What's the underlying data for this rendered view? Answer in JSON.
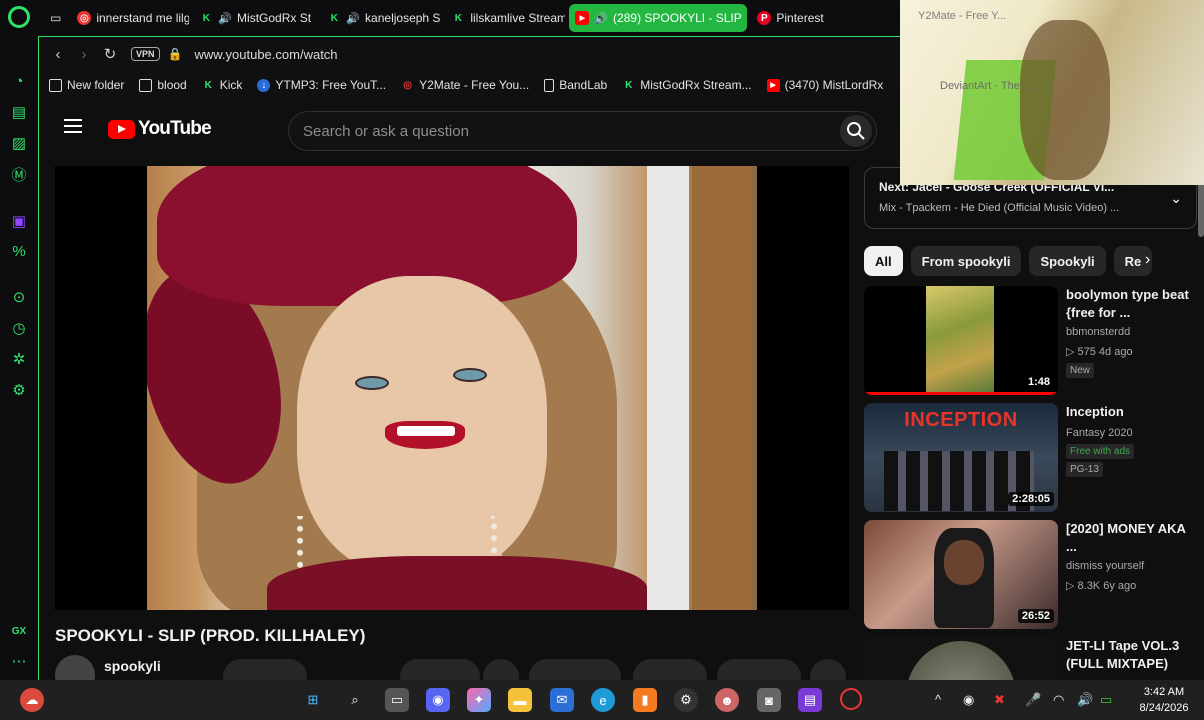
{
  "tabs": [
    {
      "label": "innerstand me lilg",
      "color": "#e33"
    },
    {
      "label": "MistGodRx St",
      "color": "#2fe26a",
      "audio": true
    },
    {
      "label": "kaneljoseph S",
      "color": "#2fe26a",
      "audio": true
    },
    {
      "label": "lilskamlive Stream",
      "color": "#2fe26a"
    },
    {
      "label": "(289) SPOOKYLI - SLIP",
      "color": "#ff0000",
      "audio": true,
      "active": true
    },
    {
      "label": "Pinterest",
      "color": "#e60023"
    }
  ],
  "address": {
    "vpn": "VPN",
    "url": "www.youtube.com/watch"
  },
  "bookmarks": [
    {
      "label": "New folder",
      "icon": "folder-icon"
    },
    {
      "label": "blood",
      "icon": "folder-icon"
    },
    {
      "label": "Kick",
      "icon": "kick-icon"
    },
    {
      "label": "YTMP3: Free YouT...",
      "icon": "download-icon"
    },
    {
      "label": "Y2Mate - Free You...",
      "icon": "y2mate-icon"
    },
    {
      "label": "BandLab",
      "icon": "document-icon"
    },
    {
      "label": "MistGodRx Stream...",
      "icon": "kick-icon"
    },
    {
      "label": "(3470) MistLordRx",
      "icon": "youtube-icon"
    }
  ],
  "youtube": {
    "logo": "YouTube",
    "search_placeholder": "Search or ask a question"
  },
  "video": {
    "title": "SPOOKYLI - SLIP (PROD. KILLHALEY)",
    "channel": "spookyli"
  },
  "upnext": {
    "next": "Next: Jacel - Goose Creek (OFFICIAL VI...",
    "mix": "Mix - Tpackem - He Died (Official Music Video) ..."
  },
  "chips": [
    "All",
    "From spookyli",
    "Spookyli",
    "Re"
  ],
  "recommendations": [
    {
      "title": "boolymon type beat {free for ...",
      "channel": "bbmonsterdd",
      "meta": "▷ 575  4d ago",
      "badge": "New",
      "duration": "1:48"
    },
    {
      "title": "Inception",
      "channel": "Fantasy 2020",
      "badge_green": "Free with ads",
      "badge": "PG-13",
      "duration": "2:28:05",
      "thumb_text": "INCEPTION"
    },
    {
      "title": "[2020] MONEY AKA ...",
      "channel": "dismiss yourself",
      "meta": "▷ 8.3K  6y ago",
      "duration": "26:52"
    },
    {
      "title": "JET-LI Tape VOL.3 (FULL MIXTAPE)"
    }
  ],
  "overlay": {
    "tab": "Y2Mate - Free Y...",
    "watermark": "DeviantArt - The ..."
  },
  "taskbar": {
    "time": "3:42 AM",
    "date": "8/24/2026"
  }
}
